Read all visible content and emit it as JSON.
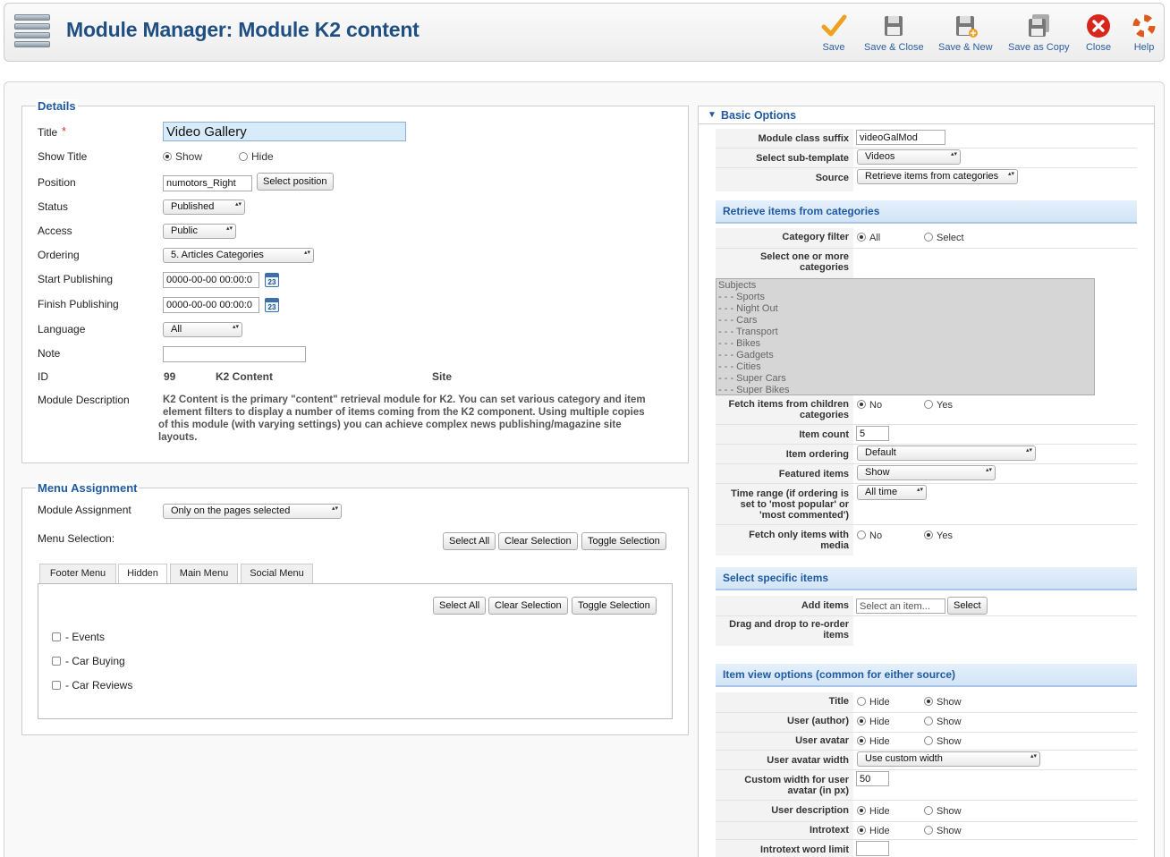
{
  "page_title": "Module Manager: Module K2 content",
  "toolbar": {
    "save": "Save",
    "save_close": "Save & Close",
    "save_new": "Save & New",
    "save_copy": "Save as Copy",
    "close": "Close",
    "help": "Help"
  },
  "details": {
    "legend": "Details",
    "title_label": "Title",
    "required_mark": "*",
    "title_value": "Video Gallery",
    "show_title_label": "Show Title",
    "show_opt": "Show",
    "hide_opt": "Hide",
    "position_label": "Position",
    "position_value": "numotors_Right",
    "select_position": "Select position",
    "status_label": "Status",
    "status_value": "Published",
    "access_label": "Access",
    "access_value": "Public",
    "ordering_label": "Ordering",
    "ordering_value": "5. Articles Categories",
    "start_label": "Start Publishing",
    "start_value": "0000-00-00 00:00:0",
    "finish_label": "Finish Publishing",
    "finish_value": "0000-00-00 00:00:0",
    "calendar_day": "23",
    "language_label": "Language",
    "language_value": "All",
    "note_label": "Note",
    "note_value": "",
    "id_label": "ID",
    "id_value": "99",
    "module_name": "K2 Content",
    "client": "Site",
    "desc_label": "Module Description",
    "desc_line1": "K2 Content is the primary \"content\" retrieval module for K2. You can set various category and item",
    "desc_line2": "element filters to display a number of items coming from the K2 component. Using multiple copies",
    "desc_line3": "of this module (with varying settings) you can achieve complex news publishing/magazine site",
    "desc_line4": "layouts."
  },
  "menu": {
    "legend": "Menu Assignment",
    "assignment_label": "Module Assignment",
    "assignment_value": "Only on the pages selected",
    "selection_label": "Menu Selection:",
    "select_all": "Select All",
    "clear_selection": "Clear Selection",
    "toggle_selection": "Toggle Selection",
    "tabs": [
      "Footer Menu",
      "Hidden",
      "Main Menu",
      "Social Menu"
    ],
    "items": [
      "- Events",
      "- Car Buying",
      "- Car Reviews"
    ]
  },
  "basic": {
    "header": "Basic Options",
    "suffix_label": "Module class suffix",
    "suffix_value": "videoGalMod",
    "subtemplate_label": "Select sub-template",
    "subtemplate_value": "Videos",
    "source_label": "Source",
    "source_value": "Retrieve items from categories"
  },
  "categories": {
    "header": "Retrieve items from categories",
    "filter_label": "Category filter",
    "all_opt": "All",
    "select_opt": "Select",
    "select_label_1": "Select one or more",
    "select_label_2": "categories",
    "list": [
      "Subjects",
      "- - - Sports",
      "- - - Night Out",
      "- - - Cars",
      "- - - Transport",
      "- - - Bikes",
      "- - - Gadgets",
      "- - - Cities",
      "- - - Super Cars",
      "- - - Super Bikes"
    ],
    "children_label_1": "Fetch items from children",
    "children_label_2": "categories",
    "no_opt": "No",
    "yes_opt": "Yes",
    "count_label": "Item count",
    "count_value": "5",
    "ordering_label": "Item ordering",
    "ordering_value": "Default",
    "featured_label": "Featured items",
    "featured_value": "Show",
    "timerange_label_1": "Time range (if ordering is",
    "timerange_label_2": "set to 'most popular' or",
    "timerange_label_3": "'most commented')",
    "timerange_value": "All time",
    "media_label_1": "Fetch only items with",
    "media_label_2": "media"
  },
  "specific": {
    "header": "Select specific items",
    "add_label": "Add items",
    "add_placeholder": "Select an item...",
    "select_btn": "Select",
    "drag_label_1": "Drag and drop to re-order",
    "drag_label_2": "items"
  },
  "itemview": {
    "header": "Item view options (common for either source)",
    "hide_opt": "Hide",
    "show_opt": "Show",
    "title_label": "Title",
    "author_label": "User (author)",
    "avatar_label": "User avatar",
    "avatar_width_label": "User avatar width",
    "avatar_width_value": "Use custom width",
    "custom_width_label_1": "Custom width for user",
    "custom_width_label_2": "avatar (in px)",
    "custom_width_value": "50",
    "description_label": "User description",
    "introtext_label": "Introtext",
    "wordlimit_label": "Introtext word limit",
    "wordlimit_value": ""
  },
  "colors": {
    "accent": "#1f5aa0",
    "section_bg": "#d9e8f7",
    "save": "#f0a020",
    "close": "#d9261c"
  }
}
